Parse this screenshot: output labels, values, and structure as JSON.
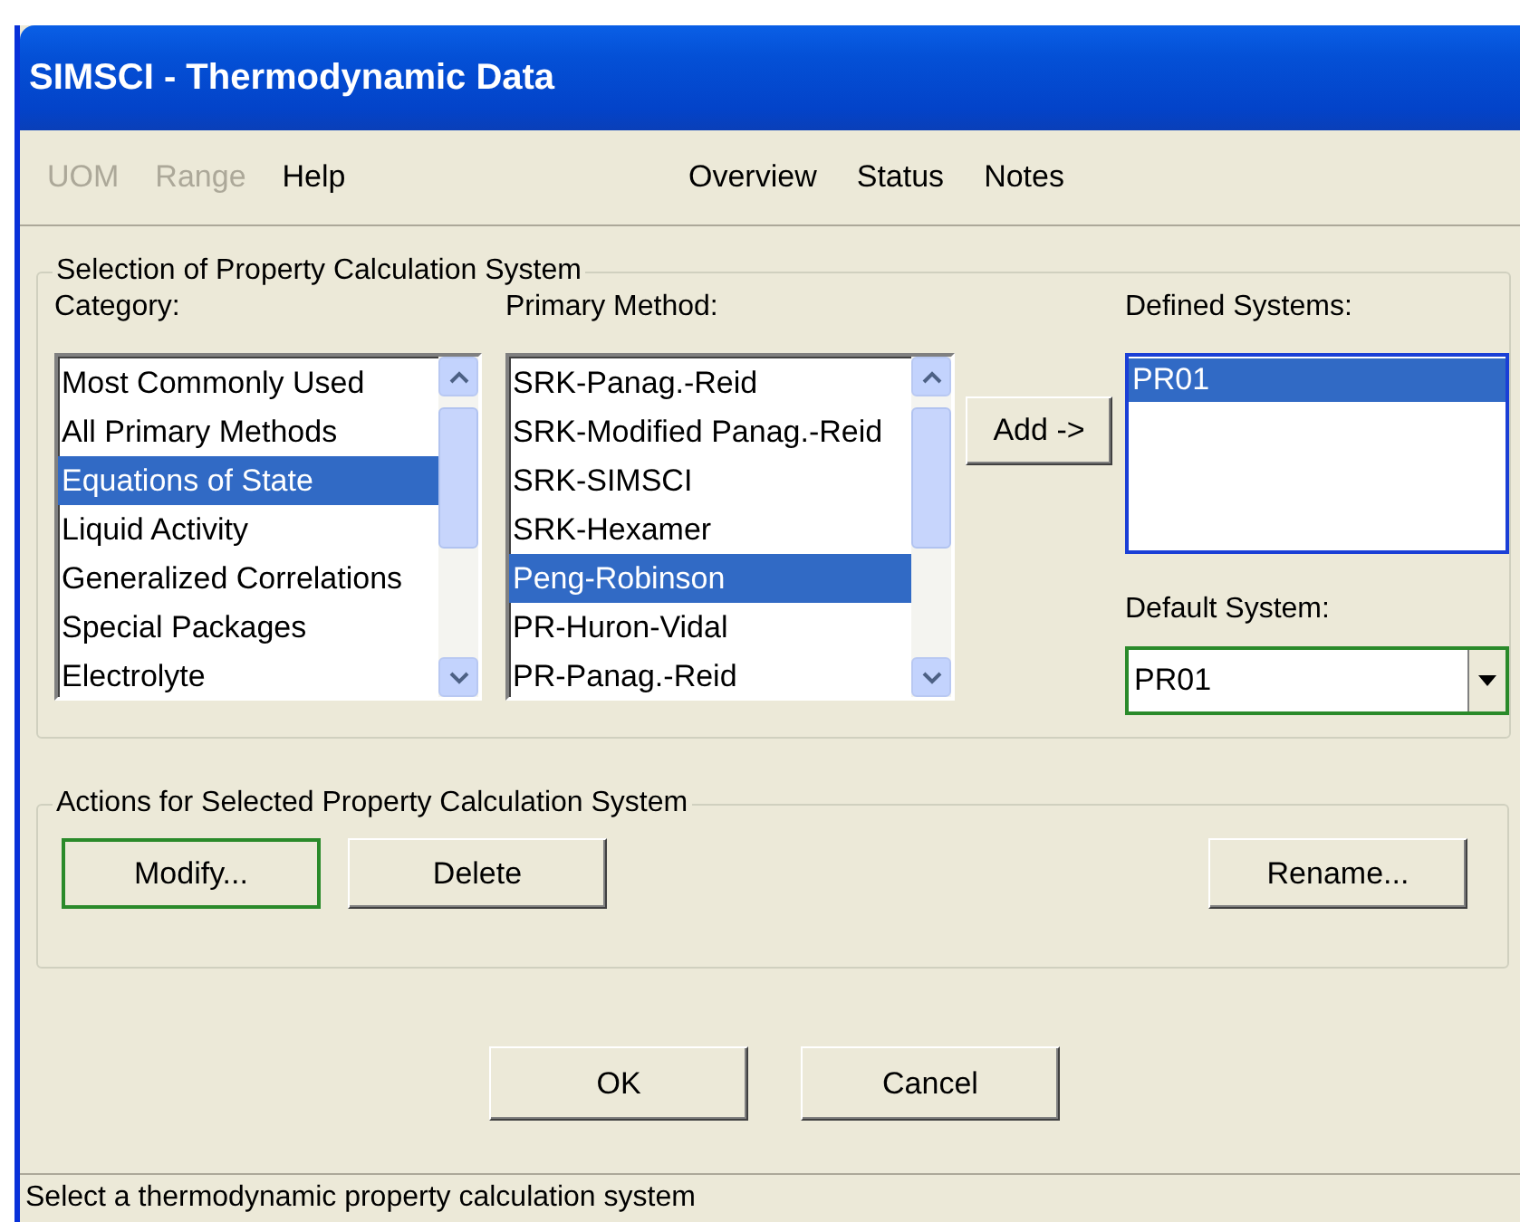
{
  "window": {
    "title": "SIMSCI - Thermodynamic Data"
  },
  "menu": {
    "items": [
      {
        "label": "UOM",
        "disabled": true
      },
      {
        "label": "Range",
        "disabled": true
      },
      {
        "label": "Help",
        "disabled": false
      }
    ],
    "links": [
      {
        "label": "Overview",
        "disabled": false
      },
      {
        "label": "Status",
        "disabled": false
      },
      {
        "label": "Notes",
        "disabled": false
      }
    ]
  },
  "selection_group": {
    "title": "Selection of Property Calculation System",
    "category": {
      "label": "Category:",
      "items": [
        {
          "label": "Most Commonly Used",
          "selected": false
        },
        {
          "label": "All Primary Methods",
          "selected": false
        },
        {
          "label": "Equations of State",
          "selected": true
        },
        {
          "label": "Liquid Activity",
          "selected": false
        },
        {
          "label": "Generalized Correlations",
          "selected": false
        },
        {
          "label": "Special Packages",
          "selected": false
        },
        {
          "label": "Electrolyte",
          "selected": false
        }
      ]
    },
    "primary_method": {
      "label": "Primary Method:",
      "items": [
        {
          "label": "SRK-Panag.-Reid",
          "selected": false
        },
        {
          "label": "SRK-Modified Panag.-Reid",
          "selected": false
        },
        {
          "label": "SRK-SIMSCI",
          "selected": false
        },
        {
          "label": "SRK-Hexamer",
          "selected": false
        },
        {
          "label": "Peng-Robinson",
          "selected": true
        },
        {
          "label": "PR-Huron-Vidal",
          "selected": false
        },
        {
          "label": "PR-Panag.-Reid",
          "selected": false
        }
      ]
    },
    "add_button": "Add ->",
    "defined_systems": {
      "label": "Defined Systems:",
      "items": [
        {
          "label": "PR01",
          "selected": true
        }
      ]
    },
    "default_system": {
      "label": "Default System:",
      "value": "PR01"
    }
  },
  "actions_group": {
    "title": "Actions for Selected Property Calculation System",
    "buttons": [
      {
        "label": "Modify...",
        "default": true
      },
      {
        "label": "Delete",
        "default": false
      },
      {
        "label": "Rename...",
        "default": false
      }
    ]
  },
  "dialog_buttons": [
    {
      "label": "OK"
    },
    {
      "label": "Cancel"
    }
  ],
  "status_bar": "Select a thermodynamic property calculation system"
}
